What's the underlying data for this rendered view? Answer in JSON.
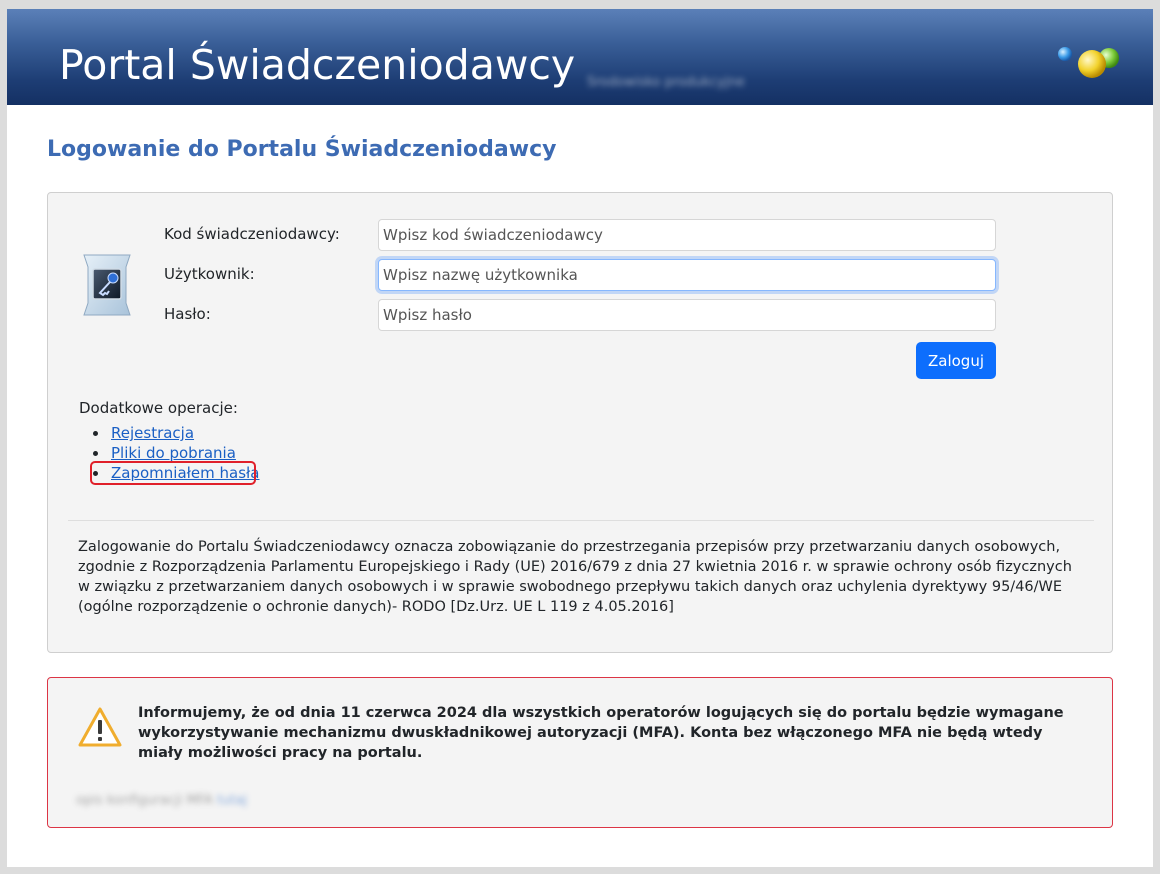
{
  "header": {
    "title": "Portal Świadczeniodawcy",
    "blurred_info": "Środowisko produkcyjne"
  },
  "page": {
    "title": "Logowanie do Portalu Świadczeniodawcy"
  },
  "form": {
    "provider_code_label": "Kod świadczeniodawcy:",
    "provider_code_placeholder": "Wpisz kod świadczeniodawcy",
    "provider_code_value": "",
    "user_label": "Użytkownik:",
    "user_placeholder": "Wpisz nazwę użytkownika",
    "user_value": "",
    "password_label": "Hasło:",
    "password_placeholder": "Wpisz hasło",
    "password_value": "",
    "login_button": "Zaloguj"
  },
  "extra": {
    "title": "Dodatkowe operacje:",
    "links": [
      "Rejestracja",
      "Pliki do pobrania",
      "Zapomniałem hasła"
    ]
  },
  "rodo": {
    "text": "Zalogowanie do Portalu Świadczeniodawcy oznacza zobowiązanie do przestrzegania przepisów przy przetwarzaniu danych osobowych, zgodnie z Rozporządzenia Parlamentu Europejskiego i Rady (UE) 2016/679 z dnia 27 kwietnia 2016 r. w sprawie ochrony osób fizycznych w związku z przetwarzaniem danych osobowych i w sprawie swobodnego przepływu takich danych oraz uchylenia dyrektywy 95/46/WE (ogólne rozporządzenie o ochronie danych)- RODO [Dz.Urz. UE L 119 z 4.05.2016]"
  },
  "alert": {
    "text": "Informujemy, że od dnia 11 czerwca 2024 dla wszystkich operatorów logujących się do portalu będzie wymagane wykorzystywanie mechanizmu dwuskładnikowej autoryzacji (MFA). Konta bez włączonego MFA nie będą wtedy miały możliwości pracy na portalu.",
    "blurred_text": "opis konfiguracji MFA",
    "blurred_link": "tutaj"
  },
  "colors": {
    "accent": "#3d6bb3",
    "button": "#0d6efd",
    "link": "#1a5fc4",
    "alert_border": "#dc3545",
    "highlight": "#e0202a"
  }
}
